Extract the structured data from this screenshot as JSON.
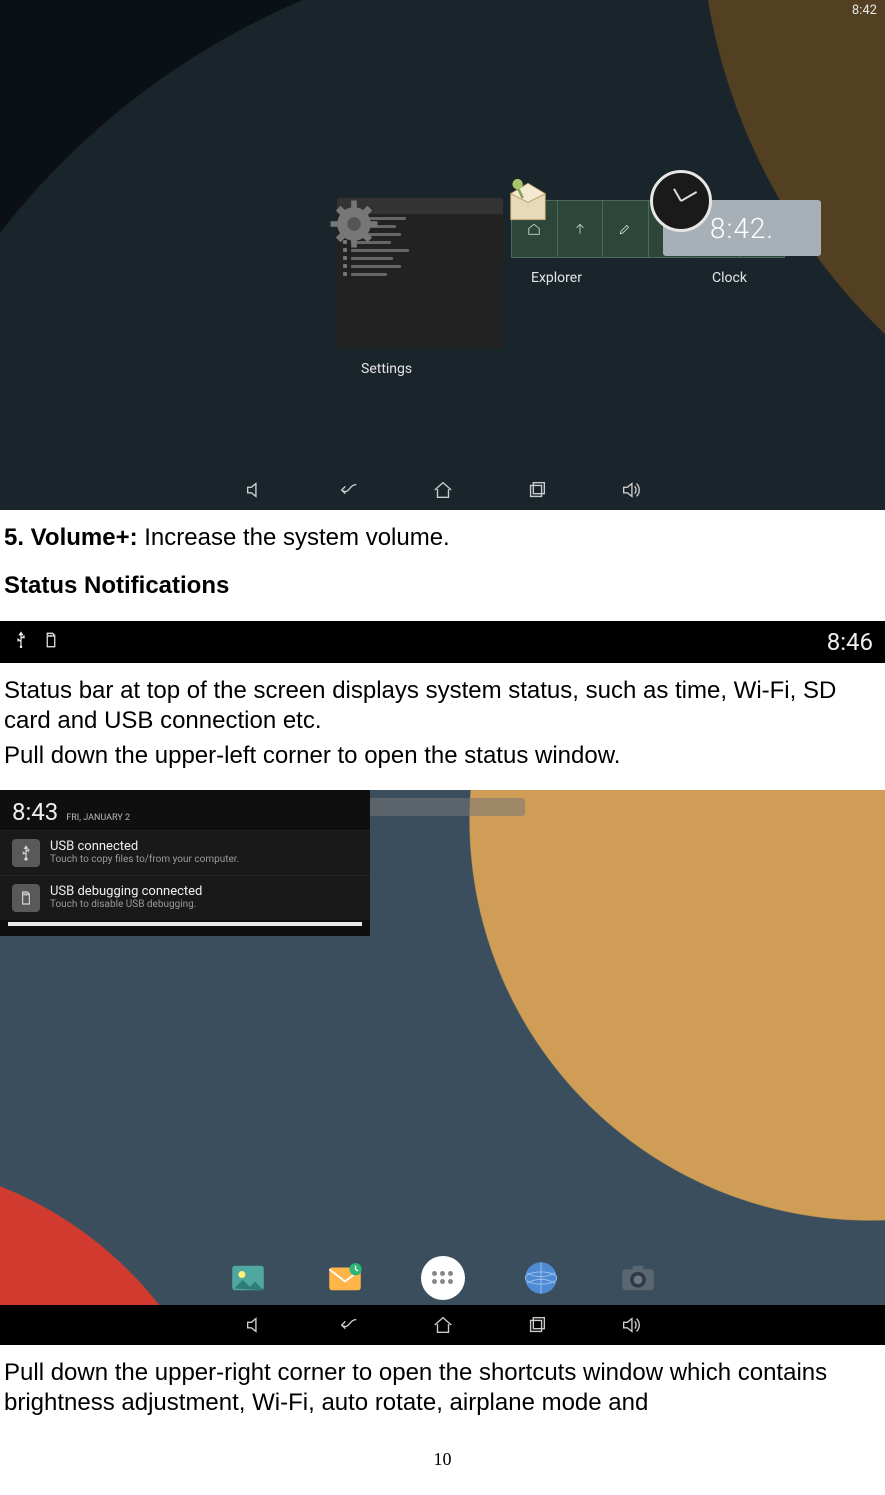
{
  "screenshot1": {
    "status_time": "8:42",
    "settings_label": "Settings",
    "explorer_label": "Explorer",
    "clock_label": "Clock",
    "clock_widget_text": "8:42."
  },
  "text1": {
    "item_prefix": "5. Volume+: ",
    "item_desc": "Increase the system volume.",
    "heading": "Status Notifications"
  },
  "statusbar2": {
    "time": "8:46"
  },
  "text2": {
    "p1": "Status bar at top of the screen displays system status, such as time, Wi-Fi, SD card and USB connection etc.",
    "p2": "Pull down the upper-left corner to open the status window."
  },
  "screenshot3": {
    "time": "8:43",
    "date": "FRI, JANUARY 2",
    "notif1": {
      "title": "USB connected",
      "sub": "Touch to copy files to/from your computer."
    },
    "notif2": {
      "title": "USB debugging connected",
      "sub": "Touch to disable USB debugging."
    }
  },
  "text3": {
    "p": "Pull down the upper-right corner to open the shortcuts window which contains brightness adjustment, Wi-Fi, auto rotate, airplane mode and"
  },
  "page_number": "10"
}
